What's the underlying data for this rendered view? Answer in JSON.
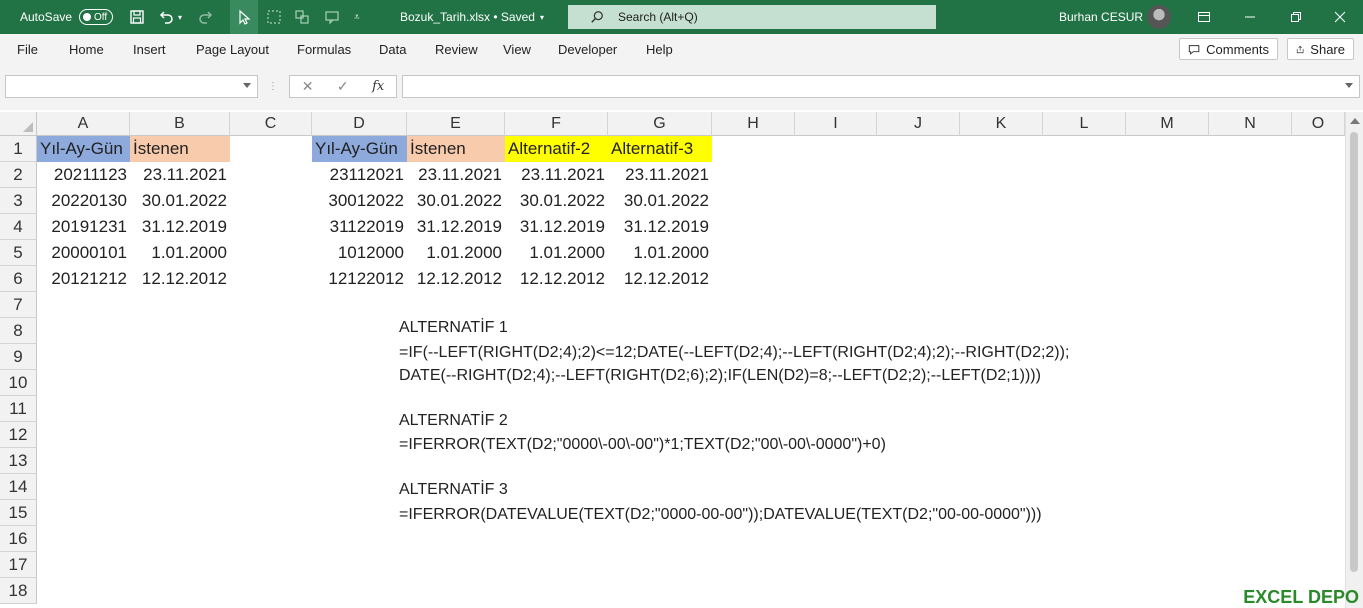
{
  "titlebar": {
    "autosave_label": "AutoSave",
    "autosave_state": "Off",
    "filename": "Bozuk_Tarih.xlsx • Saved",
    "search_placeholder": "Search (Alt+Q)",
    "user_name": "Burhan CESUR"
  },
  "ribbon": {
    "tabs": [
      "File",
      "Home",
      "Insert",
      "Page Layout",
      "Formulas",
      "Data",
      "Review",
      "View",
      "Developer",
      "Help"
    ],
    "comments_label": "Comments",
    "share_label": "Share"
  },
  "formula_bar": {
    "name_box": "",
    "formula": "",
    "fx_label": "fx"
  },
  "columns": [
    "A",
    "B",
    "C",
    "D",
    "E",
    "F",
    "G",
    "H",
    "I",
    "J",
    "K",
    "L",
    "M",
    "N",
    "O"
  ],
  "rows": [
    "1",
    "2",
    "3",
    "4",
    "5",
    "6",
    "7",
    "8",
    "9",
    "10",
    "11",
    "12",
    "13",
    "14",
    "15",
    "16",
    "17",
    "18"
  ],
  "cells": {
    "A1": "Yıl-Ay-Gün",
    "B1": "İstenen",
    "D1": "Yıl-Ay-Gün",
    "E1": "İstenen",
    "F1": "Alternatif-2",
    "G1": "Alternatif-3",
    "A2": "20211123",
    "B2": "23.11.2021",
    "D2": "23112021",
    "E2": "23.11.2021",
    "F2": "23.11.2021",
    "G2": "23.11.2021",
    "A3": "20220130",
    "B3": "30.01.2022",
    "D3": "30012022",
    "E3": "30.01.2022",
    "F3": "30.01.2022",
    "G3": "30.01.2022",
    "A4": "20191231",
    "B4": "31.12.2019",
    "D4": "31122019",
    "E4": "31.12.2019",
    "F4": "31.12.2019",
    "G4": "31.12.2019",
    "A5": "20000101",
    "B5": "1.01.2000",
    "D5": "1012000",
    "E5": "1.01.2000",
    "F5": "1.01.2000",
    "G5": "1.01.2000",
    "A6": "20121212",
    "B6": "12.12.2012",
    "D6": "12122012",
    "E6": "12.12.2012",
    "F6": "12.12.2012",
    "G6": "12.12.2012"
  },
  "notes": [
    "ALTERNATİF 1",
    "=IF(--LEFT(RIGHT(D2;4);2)<=12;DATE(--LEFT(D2;4);--LEFT(RIGHT(D2;4);2);--RIGHT(D2;2));",
    "DATE(--RIGHT(D2;4);--LEFT(RIGHT(D2;6);2);IF(LEN(D2)=8;--LEFT(D2;2);--LEFT(D2;1))))",
    "ALTERNATİF 2",
    "=IFERROR(TEXT(D2;\"0000\\-00\\-00\")*1;TEXT(D2;\"00\\-00\\-0000\")+0)",
    "ALTERNATİF 3",
    "=IFERROR(DATEVALUE(TEXT(D2;\"0000-00-00\"));DATEVALUE(TEXT(D2;\"00-00-0000\")))"
  ],
  "watermark": "EXCEL DEPO",
  "colors": {
    "excel_green": "#217346",
    "header_blue": "#8EA9DB",
    "header_peach": "#F8CBAD",
    "header_yellow": "#FFFF00"
  }
}
